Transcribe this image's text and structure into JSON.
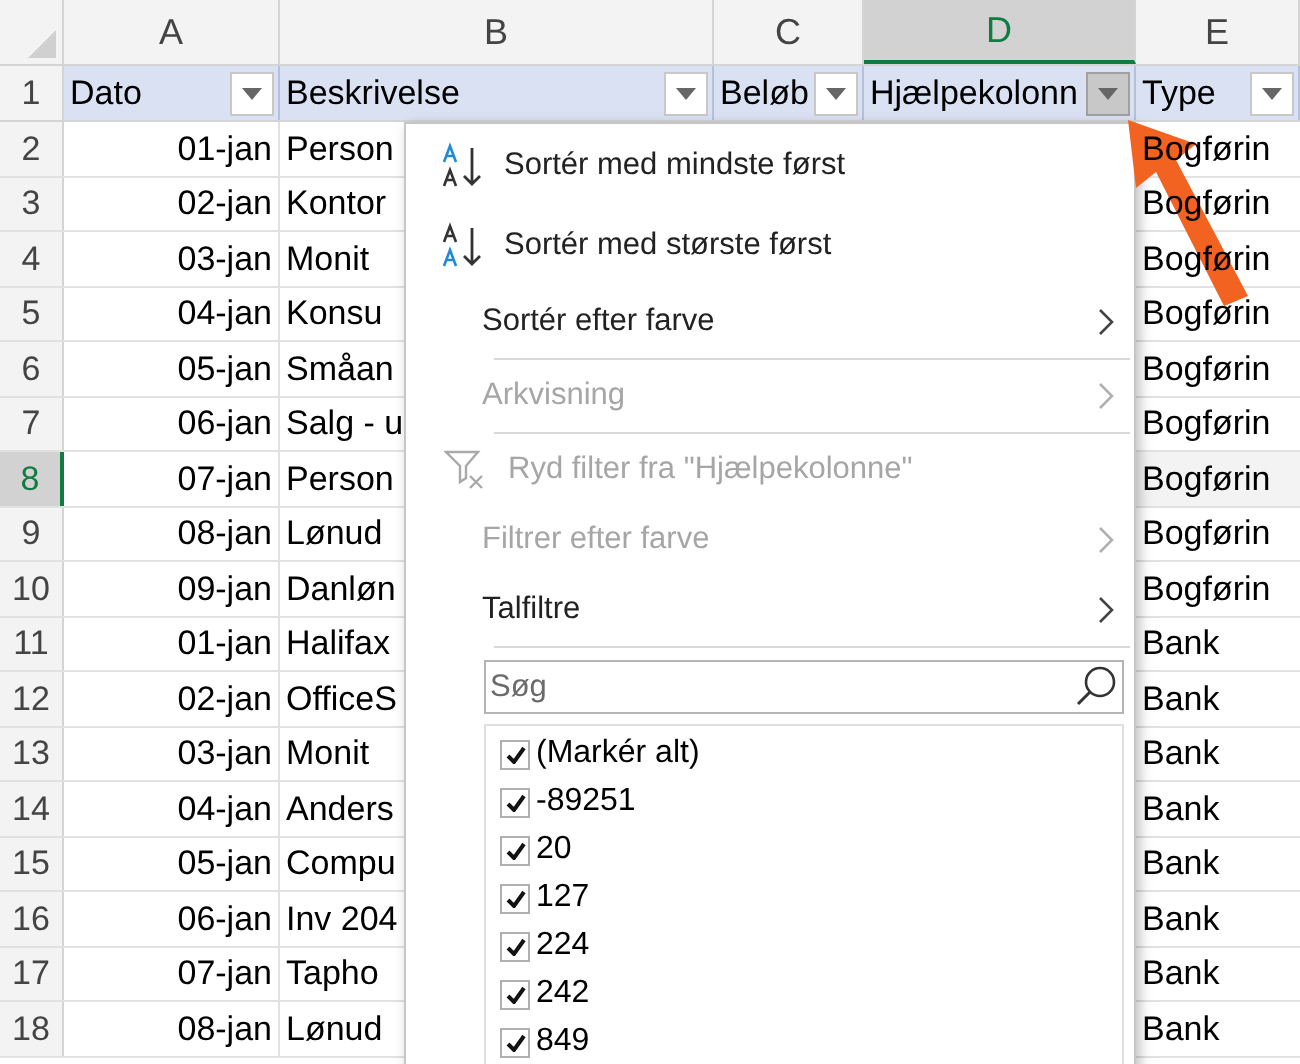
{
  "columns": [
    {
      "letter": "A",
      "selected": false
    },
    {
      "letter": "B",
      "selected": false
    },
    {
      "letter": "C",
      "selected": false
    },
    {
      "letter": "D",
      "selected": true
    },
    {
      "letter": "E",
      "selected": false
    }
  ],
  "header_row": {
    "number": "1",
    "cells": [
      {
        "text": "Dato",
        "filter_open": false
      },
      {
        "text": "Beskrivelse",
        "filter_open": false
      },
      {
        "text": "Beløb",
        "filter_open": false
      },
      {
        "text": "Hjælpekolonn",
        "filter_open": true
      },
      {
        "text": "Type",
        "filter_open": false
      }
    ]
  },
  "rows": [
    {
      "number": "2",
      "selected": false,
      "date": "01-jan",
      "description": "Person",
      "type": "Bogførin"
    },
    {
      "number": "3",
      "selected": false,
      "date": "02-jan",
      "description": "Kontor",
      "type": "Bogførin"
    },
    {
      "number": "4",
      "selected": false,
      "date": "03-jan",
      "description": "Monit",
      "type": "Bogførin"
    },
    {
      "number": "5",
      "selected": false,
      "date": "04-jan",
      "description": "Konsu",
      "type": "Bogførin"
    },
    {
      "number": "6",
      "selected": false,
      "date": "05-jan",
      "description": "Småan",
      "type": "Bogførin"
    },
    {
      "number": "7",
      "selected": false,
      "date": "06-jan",
      "description": "Salg - u",
      "type": "Bogførin"
    },
    {
      "number": "8",
      "selected": true,
      "date": "07-jan",
      "description": "Person",
      "type": "Bogførin"
    },
    {
      "number": "9",
      "selected": false,
      "date": "08-jan",
      "description": "Lønud",
      "type": "Bogførin"
    },
    {
      "number": "10",
      "selected": false,
      "date": "09-jan",
      "description": "Danløn",
      "type": "Bogførin"
    },
    {
      "number": "11",
      "selected": false,
      "date": "01-jan",
      "description": "Halifax",
      "type": "Bank"
    },
    {
      "number": "12",
      "selected": false,
      "date": "02-jan",
      "description": "OfficeS",
      "type": "Bank"
    },
    {
      "number": "13",
      "selected": false,
      "date": "03-jan",
      "description": "Monit",
      "type": "Bank"
    },
    {
      "number": "14",
      "selected": false,
      "date": "04-jan",
      "description": "Anders",
      "type": "Bank"
    },
    {
      "number": "15",
      "selected": false,
      "date": "05-jan",
      "description": "Compu",
      "type": "Bank"
    },
    {
      "number": "16",
      "selected": false,
      "date": "06-jan",
      "description": "Inv 204",
      "type": "Bank"
    },
    {
      "number": "17",
      "selected": false,
      "date": "07-jan",
      "description": "Tapho",
      "type": "Bank"
    },
    {
      "number": "18",
      "selected": false,
      "date": "08-jan",
      "description": "Lønud",
      "type": "Bank"
    }
  ],
  "filter_menu": {
    "items": [
      {
        "kind": "sort-ascending",
        "label": "Sortér med mindste først",
        "disabled": false,
        "submenu": false,
        "separator_after": false
      },
      {
        "kind": "sort-descending",
        "label": "Sortér med største først",
        "disabled": false,
        "submenu": false,
        "separator_after": false
      },
      {
        "kind": "plain",
        "label": "Sortér efter farve",
        "disabled": false,
        "submenu": true,
        "separator_after": true
      },
      {
        "kind": "plain",
        "label": "Arkvisning",
        "disabled": true,
        "submenu": true,
        "separator_after": true
      },
      {
        "kind": "clear-filter",
        "label": "Ryd filter fra \"Hjælpekolonne\"",
        "disabled": true,
        "submenu": false,
        "separator_after": false
      },
      {
        "kind": "plain",
        "label": "Filtrer efter farve",
        "disabled": true,
        "submenu": true,
        "separator_after": false
      },
      {
        "kind": "plain",
        "label": "Talfiltre",
        "disabled": false,
        "submenu": true,
        "separator_after": true
      }
    ],
    "search": {
      "placeholder": "Søg"
    },
    "values": [
      {
        "label": "(Markér alt)",
        "checked": true
      },
      {
        "label": "-89251",
        "checked": true
      },
      {
        "label": "20",
        "checked": true
      },
      {
        "label": "127",
        "checked": true
      },
      {
        "label": "224",
        "checked": true
      },
      {
        "label": "242",
        "checked": true
      },
      {
        "label": "849",
        "checked": true
      }
    ]
  }
}
